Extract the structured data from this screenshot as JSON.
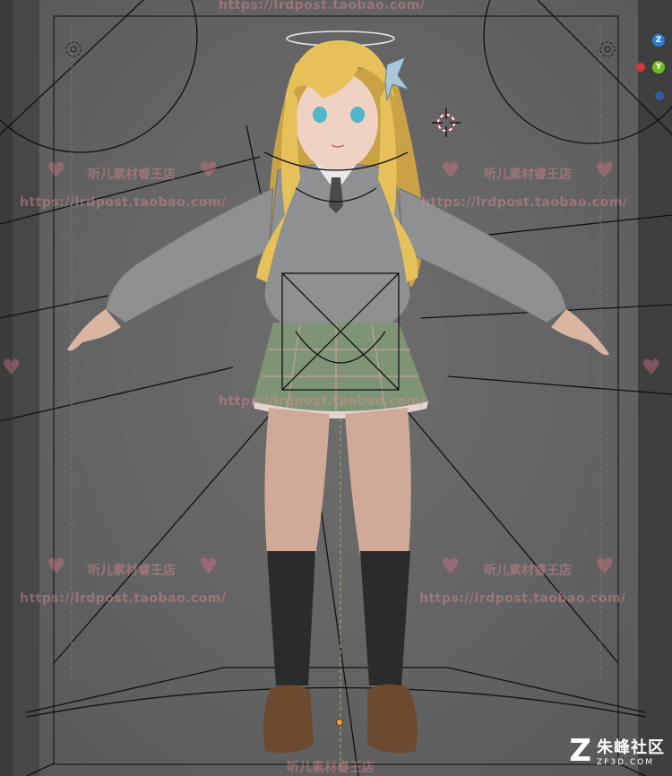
{
  "viewport": {
    "background": "#636363",
    "watermark": {
      "url": "https://lrdpost.taobao.com/",
      "shop": "听儿素材睿王店",
      "heart": "♥",
      "color": "#e18c96"
    },
    "gizmo": {
      "z_label": "Z",
      "y_label": "Y",
      "x_color": "#d13a3a",
      "y_color": "#6ec01e",
      "z_color": "#2e7bd6"
    },
    "cursor_icon": "3d-cursor-icon",
    "character": {
      "hair_color": "#e6c15a",
      "sweater_color": "#8e9092",
      "skirt_color": "#7f9474",
      "sock_color": "#2b2b2b",
      "shoe_color": "#6b4a30",
      "halo_color": "#e4e4e4"
    }
  },
  "brand": {
    "mark": "Z",
    "name": "朱峰社区",
    "domain": "ZF3D.COM"
  }
}
